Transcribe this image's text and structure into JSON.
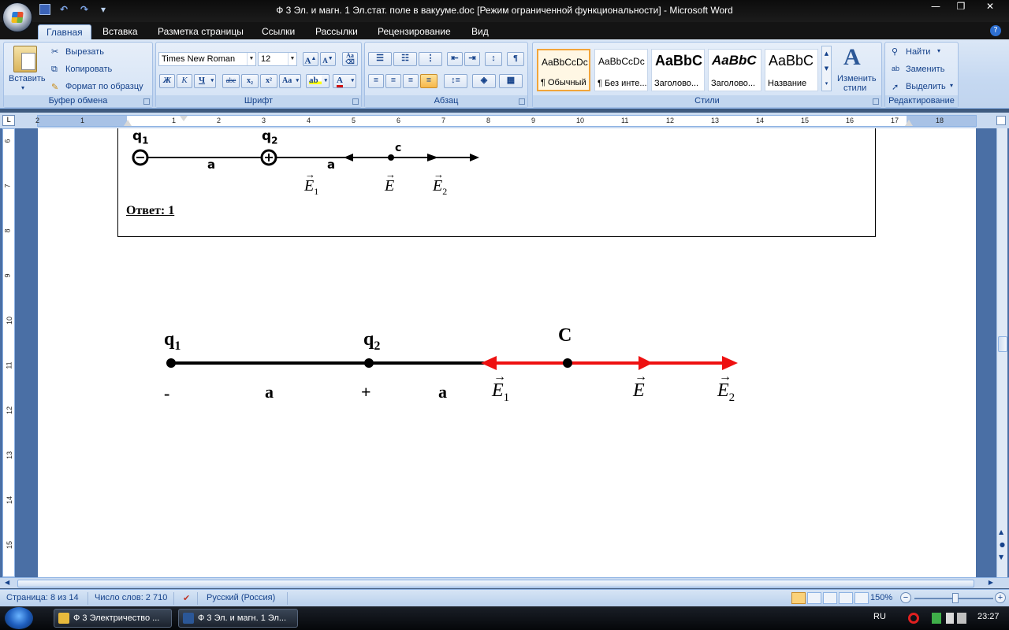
{
  "window": {
    "title": "Ф 3 Эл. и магн. 1 Эл.стат. поле в вакууме.doc [Режим ограниченной функциональности] - Microsoft Word"
  },
  "tabs": [
    {
      "label": "Главная",
      "active": true
    },
    {
      "label": "Вставка"
    },
    {
      "label": "Разметка страницы"
    },
    {
      "label": "Ссылки"
    },
    {
      "label": "Рассылки"
    },
    {
      "label": "Рецензирование"
    },
    {
      "label": "Вид"
    }
  ],
  "ribbon": {
    "clipboard": {
      "label": "Буфер обмена",
      "paste": "Вставить",
      "cut": "Вырезать",
      "copy": "Копировать",
      "format_painter": "Формат по образцу"
    },
    "font": {
      "label": "Шрифт",
      "font_name": "Times New Roman",
      "font_size": "12",
      "bold": "Ж",
      "italic": "К",
      "underline": "Ч",
      "strike": "abe",
      "subscript": "x₂",
      "superscript": "x²",
      "change_case": "Aa"
    },
    "paragraph": {
      "label": "Абзац"
    },
    "styles": {
      "label": "Стили",
      "items": [
        {
          "sample": "AaBbCcDc",
          "name": "¶ Обычный"
        },
        {
          "sample": "AaBbCcDc",
          "name": "¶ Без инте..."
        },
        {
          "sample": "AaBbC",
          "name": "Заголово..."
        },
        {
          "sample": "AaBbC",
          "name": "Заголово..."
        },
        {
          "sample": "AaBbC",
          "name": "Название"
        }
      ],
      "change_styles_1": "Изменить",
      "change_styles_2": "стили"
    },
    "editing": {
      "label": "Редактирование",
      "find": "Найти",
      "replace": "Заменить",
      "select": "Выделить"
    }
  },
  "ruler": {
    "h_numbers": [
      "2",
      "1",
      "1",
      "2",
      "3",
      "4",
      "5",
      "6",
      "7",
      "8",
      "9",
      "10",
      "11",
      "12",
      "13",
      "14",
      "15",
      "16",
      "17",
      "18"
    ],
    "v_numbers": [
      "6",
      "7",
      "8",
      "9",
      "10",
      "11",
      "12",
      "13",
      "14",
      "15"
    ],
    "corner": "L"
  },
  "document": {
    "small_figure": {
      "q1": "q",
      "q1_sub": "1",
      "q2": "q",
      "q2_sub": "2",
      "a_left": "a",
      "a_right": "a",
      "c": "c",
      "e1": "E",
      "e1_sub": "1",
      "e": "E",
      "e2": "E",
      "e2_sub": "2"
    },
    "answer": "Ответ: 1",
    "big_figure": {
      "q1": "q",
      "q1_sub": "1",
      "q2": "q",
      "q2_sub": "2",
      "c": "C",
      "minus": "-",
      "a_left": "a",
      "plus": "+",
      "a_right": "a",
      "e1": "E",
      "e1_sub": "1",
      "e": "E",
      "e2": "E",
      "e2_sub": "2",
      "arrow_color": "#ee1111"
    }
  },
  "statusbar": {
    "page": "Страница: 8 из 14",
    "words": "Число слов: 2 710",
    "language": "Русский (Россия)",
    "zoom": "150%"
  },
  "taskbar": {
    "buttons": [
      {
        "label": "Ф 3 Электричество ..."
      },
      {
        "label": "Ф 3 Эл. и магн. 1 Эл..."
      }
    ],
    "lang": "RU",
    "clock": "23:27"
  }
}
